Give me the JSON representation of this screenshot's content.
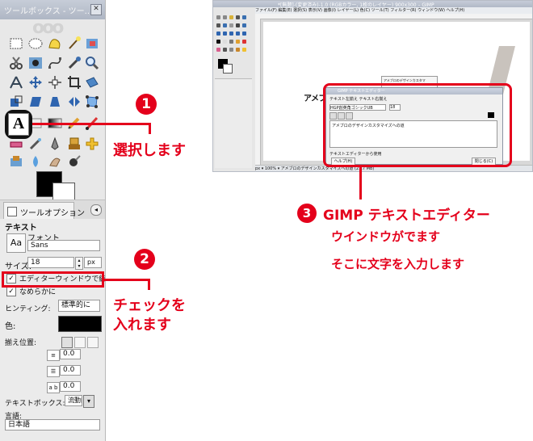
{
  "toolbox": {
    "title": "ツールボックス - ツー...",
    "close_glyph": "✕",
    "tool_options_tab": "ツールオプション",
    "tool_options_menu_glyph": "◂",
    "tool_name": "テキスト",
    "font_section_label": "フォント",
    "font_preview": "Aa",
    "font_value": "Sans",
    "size_label": "サイズ:",
    "size_value": "18",
    "size_unit": "px",
    "editor_checkbox_label": "エディターウィンドウで編集",
    "antialias_label": "なめらかに",
    "hinting_label": "ヒンティング:",
    "hinting_value": "標準的に",
    "color_label": "色:",
    "justify_label": "揃え位置:",
    "indent_value": "0.0",
    "line_spacing_value": "0.0",
    "letter_spacing_value": "0.0",
    "letter_spacing_icon": "a b",
    "textbox_label": "テキストボックス:",
    "textbox_value": "流動的",
    "language_label": "言語:",
    "language_value": "日本語",
    "logo_text": "ooo"
  },
  "gimp_window": {
    "title": "*[無題]-(変更済み)-1.0 (RGBカラー, 1枚のレイヤー) 900x300 – GIMP",
    "menu": "ファイル(F)  編集(E)  選択(S)  表示(V)  画像(I)  レイヤー(L)  色(C)  ツール(T)  フィルター(R)  ウィンドウ(W)  ヘルプ(H)",
    "canvas_heading": "アメブロのデザインカスタマイズへの道",
    "textbox_text": "アメブロのデザインカスタマ",
    "status_text": "px ▾  100% ▾  アメブロのデザインカスタマイズへの道 (21.7 MB)",
    "editor": {
      "title": "GIMP テキストエディター",
      "tabs": "テキスト左揃え   テキスト右揃え",
      "font_value": "HGP創英角ゴシックUB",
      "size_value": "18",
      "content": "アメブロのデザインカスタマイズへの道",
      "check_label": "テキストエディターから使用",
      "help_button": "ヘルプ(H)",
      "close_button": "閉じる(C)"
    }
  },
  "annotations": {
    "step1_number": "1",
    "step1_text": "選択します",
    "step2_number": "2",
    "step2_line1": "チェックを",
    "step2_line2": "入れます",
    "step3_number": "3",
    "step3_line1": "GIMP テキストエディター",
    "step3_line2": "ウインドウがでます",
    "step3_line3": "そこに文字を入力します"
  },
  "colors": {
    "annotation_red": "#e4001b",
    "foreground": "#000000",
    "background": "#ffffff"
  }
}
